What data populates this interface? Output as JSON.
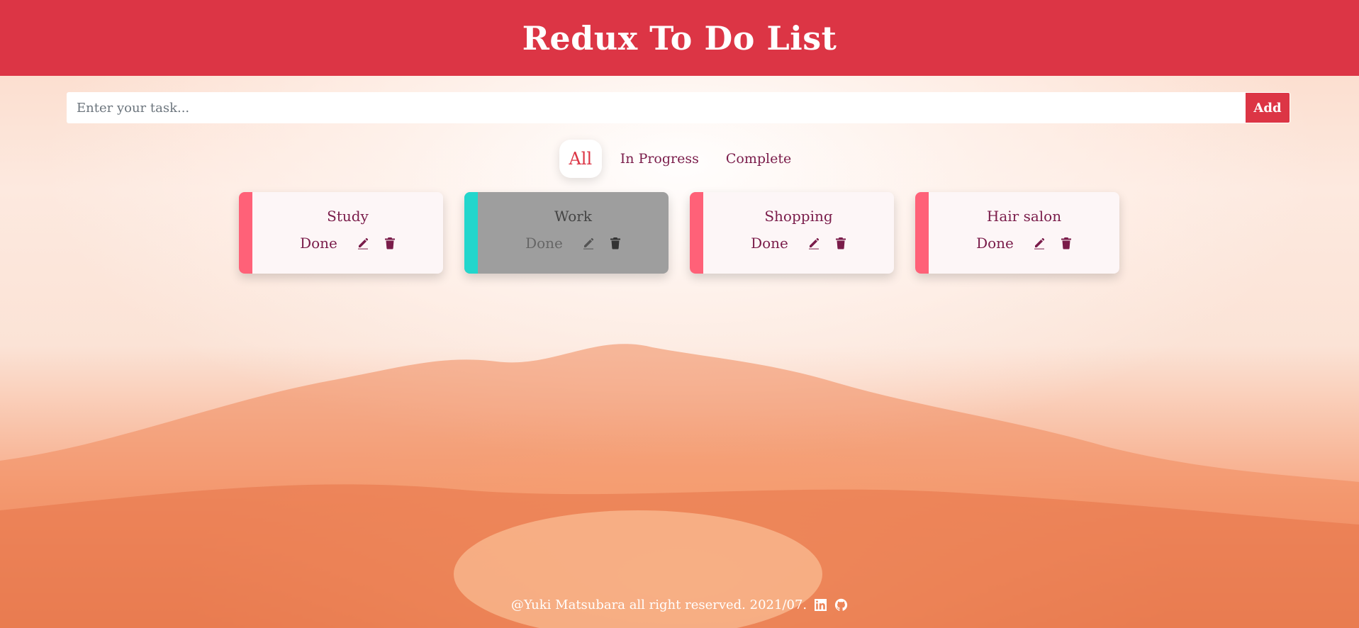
{
  "header": {
    "title": "Redux To Do List"
  },
  "form": {
    "placeholder": "Enter your task...",
    "value": "",
    "add_label": "Add"
  },
  "tabs": [
    {
      "label": "All",
      "active": true
    },
    {
      "label": "In Progress",
      "active": false
    },
    {
      "label": "Complete",
      "active": false
    }
  ],
  "tasks": [
    {
      "title": "Study",
      "done_label": "Done",
      "status": "in-progress"
    },
    {
      "title": "Work",
      "done_label": "Done",
      "status": "complete"
    },
    {
      "title": "Shopping",
      "done_label": "Done",
      "status": "in-progress"
    },
    {
      "title": "Hair salon",
      "done_label": "Done",
      "status": "in-progress"
    }
  ],
  "footer": {
    "text": "@Yuki Matsubara all right reserved. 2021/07.",
    "icons": [
      "linkedin-icon",
      "github-icon"
    ]
  },
  "colors": {
    "header": "#dc3545",
    "accent": "#dc3545",
    "text": "#7a1c4a",
    "stripe_active": "#ff6178",
    "stripe_complete": "#22d6cc",
    "card_complete_bg": "#9e9e9e"
  }
}
